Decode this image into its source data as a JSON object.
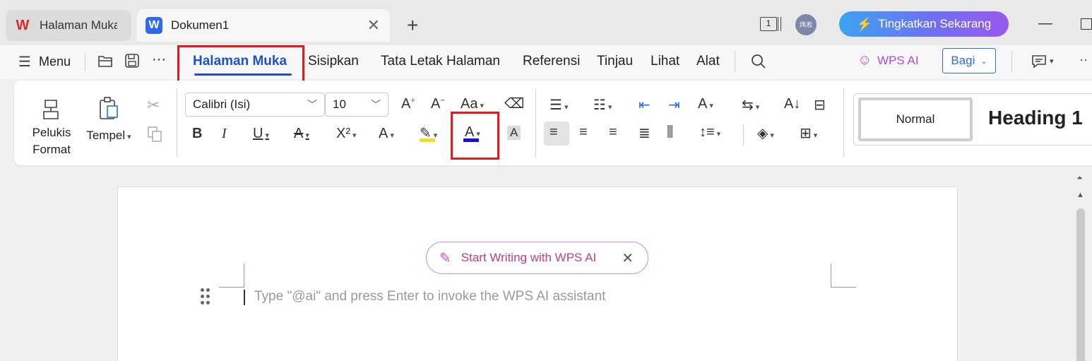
{
  "tabs": [
    {
      "label": "Halaman Muka",
      "logo": "W"
    },
    {
      "label": "Dokumen1",
      "logo": "W"
    }
  ],
  "titlebar": {
    "new_tab": "+",
    "page_count": "1",
    "avatar_text": "炜淞",
    "upgrade_label": "Tingkatkan Sekarang"
  },
  "menubar": {
    "menu_label": "Menu",
    "more": "···",
    "items": [
      "Halaman Muka",
      "Sisipkan",
      "Tata Letak Halaman",
      "Referensi",
      "Tinjau",
      "Lihat",
      "Alat"
    ],
    "wps_ai": "WPS AI",
    "share_label": "Bagi"
  },
  "ribbon": {
    "format_painter": [
      "Pelukis",
      "Format"
    ],
    "paste": "Tempel",
    "font_name": "Calibri (Isi)",
    "font_size": "10",
    "font_color": "#1414d6",
    "highlight_color": "#f0e020"
  },
  "styles": {
    "normal": "Normal",
    "heading1": "Heading 1"
  },
  "document": {
    "ai_prompt": "Start Writing with WPS AI",
    "placeholder": "Type \"@ai\" and press Enter to invoke the WPS AI assistant"
  },
  "colors": {
    "accent": "#2150c7",
    "highlight_box": "#e2191d"
  }
}
